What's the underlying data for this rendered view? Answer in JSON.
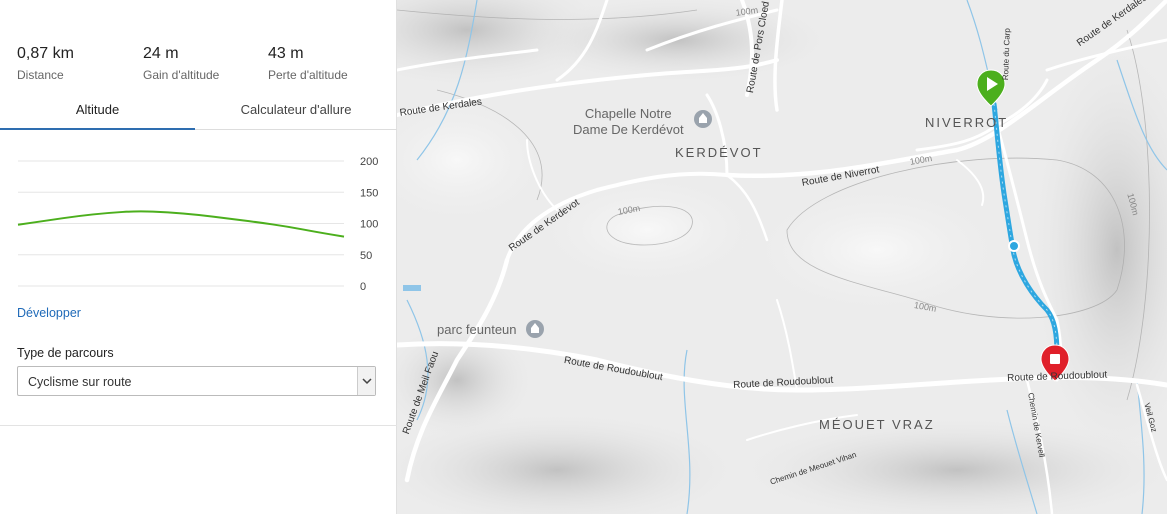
{
  "stats": {
    "distance": {
      "value": "0,87 km",
      "label": "Distance"
    },
    "gain": {
      "value": "24 m",
      "label": "Gain d'altitude"
    },
    "loss": {
      "value": "43 m",
      "label": "Perte d'altitude"
    }
  },
  "tabs": [
    {
      "label": "Altitude",
      "active": true
    },
    {
      "label": "Calculateur d'allure",
      "active": false
    }
  ],
  "elevation": {
    "yticks": [
      "200",
      "150",
      "100",
      "50",
      "0"
    ],
    "ymin": 0,
    "ymax": 200,
    "profile": [
      {
        "d": 0.0,
        "alt": 98
      },
      {
        "d": 0.08,
        "alt": 105
      },
      {
        "d": 0.16,
        "alt": 112
      },
      {
        "d": 0.24,
        "alt": 117
      },
      {
        "d": 0.32,
        "alt": 120
      },
      {
        "d": 0.4,
        "alt": 118
      },
      {
        "d": 0.48,
        "alt": 114
      },
      {
        "d": 0.56,
        "alt": 108
      },
      {
        "d": 0.64,
        "alt": 102
      },
      {
        "d": 0.72,
        "alt": 95
      },
      {
        "d": 0.8,
        "alt": 86
      },
      {
        "d": 0.87,
        "alt": 79
      }
    ],
    "line_color": "#4caf1d"
  },
  "develop_link": "Développer",
  "route_type": {
    "label": "Type de parcours",
    "selected": "Cyclisme sur route"
  },
  "map": {
    "places": {
      "niverrot": "NIVERROT",
      "kerdevot": "KERDÉVOT",
      "meouet_vraz": "MÉOUET VRAZ"
    },
    "pois": {
      "chapelle_line1": "Chapelle Notre",
      "chapelle_line2": "Dame De Kerdévot",
      "parc": "parc feunteun"
    },
    "roads": {
      "kerdales": "Route de Kerdales",
      "pors_cloed": "Route de Pors Cloed",
      "kerdevot": "Route de Kerdevot",
      "niverrot": "Route de Niverrot",
      "roudoublout_1": "Route de Roudoublout",
      "roudoublout_2": "Route de Roudoublout",
      "roudoublout_3": "Route de Roudoublout",
      "meil_faou": "Route de Meil Faou",
      "kerdales_top": "Route de Kerdales",
      "carp": "Route du Carp",
      "kervell": "Chemin de Kervell",
      "meouet_vihan": "Chemin de Meouet Vihan",
      "veil_goz": "Veil Goz"
    },
    "contours": {
      "c1": "100m",
      "c2": "100m",
      "c3": "100m",
      "c4": "100m",
      "c5": "100m"
    },
    "route_color": "#2ea7e0",
    "start_color": "#4caf1d",
    "end_color": "#e0202a"
  }
}
